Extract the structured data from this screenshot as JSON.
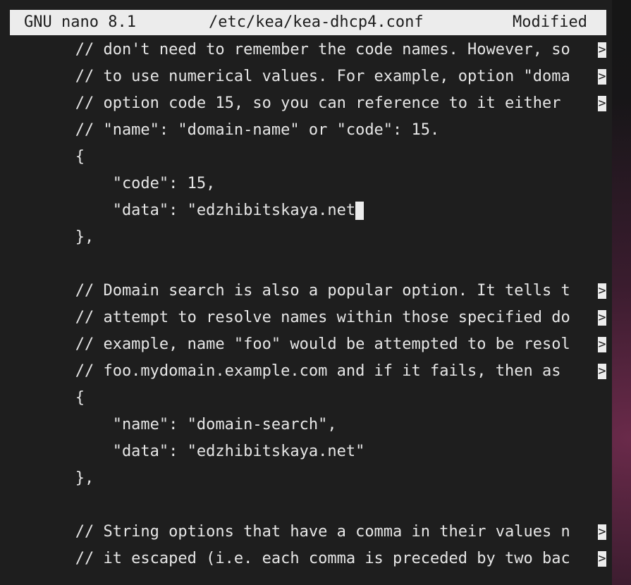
{
  "titlebar": {
    "app": "GNU nano 8.1",
    "file": "/etc/kea/kea-dhcp4.conf",
    "status": "Modified"
  },
  "overflow_marker": ">",
  "lines": [
    {
      "text": "       // don't need to remember the code names. However, so",
      "truncated": true
    },
    {
      "text": "       // to use numerical values. For example, option \"doma",
      "truncated": true
    },
    {
      "text": "       // option code 15, so you can reference to it either ",
      "truncated": true
    },
    {
      "text": "       // \"name\": \"domain-name\" or \"code\": 15.",
      "truncated": false
    },
    {
      "text": "       {",
      "truncated": false
    },
    {
      "text": "           \"code\": 15,",
      "truncated": false
    },
    {
      "text": "           \"data\": \"edzhibitskaya.net",
      "truncated": false,
      "cursor": true
    },
    {
      "text": "       },",
      "truncated": false
    },
    {
      "text": "",
      "truncated": false
    },
    {
      "text": "       // Domain search is also a popular option. It tells t",
      "truncated": true
    },
    {
      "text": "       // attempt to resolve names within those specified do",
      "truncated": true
    },
    {
      "text": "       // example, name \"foo\" would be attempted to be resol",
      "truncated": true
    },
    {
      "text": "       // foo.mydomain.example.com and if it fails, then as ",
      "truncated": true
    },
    {
      "text": "       {",
      "truncated": false
    },
    {
      "text": "           \"name\": \"domain-search\",",
      "truncated": false
    },
    {
      "text": "           \"data\": \"edzhibitskaya.net\"",
      "truncated": false
    },
    {
      "text": "       },",
      "truncated": false
    },
    {
      "text": "",
      "truncated": false
    },
    {
      "text": "       // String options that have a comma in their values n",
      "truncated": true
    },
    {
      "text": "       // it escaped (i.e. each comma is preceded by two bac",
      "truncated": true
    }
  ],
  "colors": {
    "background": "#1e1e1e",
    "foreground": "#e6e6e6",
    "titlebar_bg": "#ececec",
    "titlebar_fg": "#1e1e1e"
  }
}
